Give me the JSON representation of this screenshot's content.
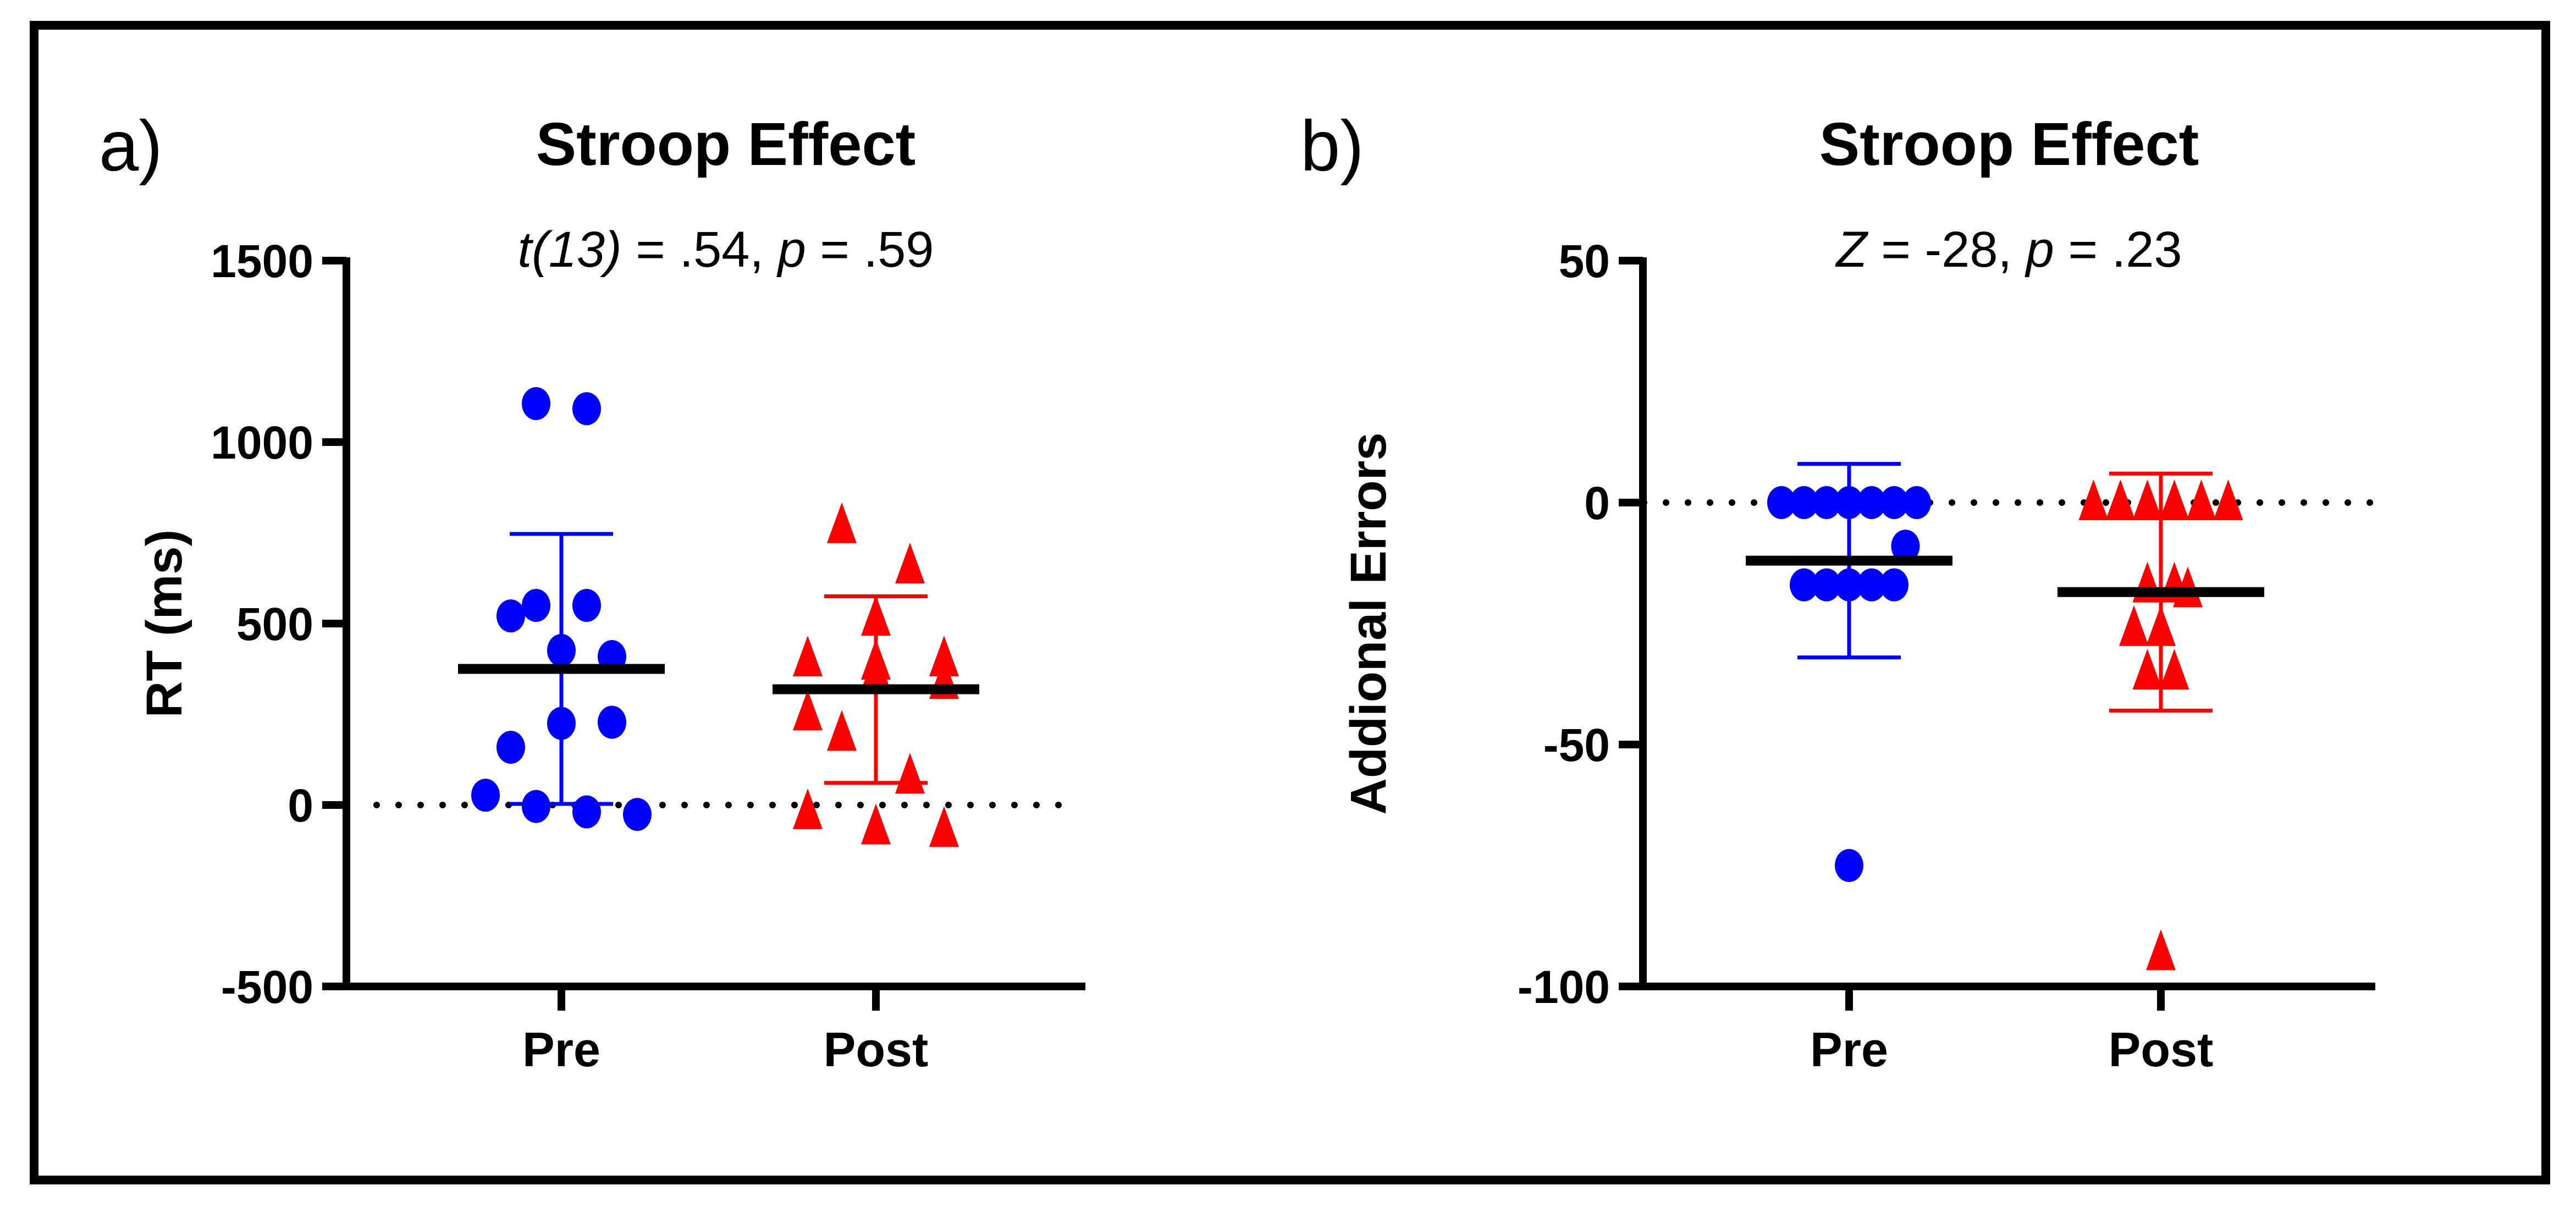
{
  "colors": {
    "pre": "#0000ff",
    "post": "#ff0000",
    "mean": "#000000",
    "frame": "#000000"
  },
  "chart_data": [
    {
      "type": "scatter",
      "panel_label": "a)",
      "title": "Stroop Effect",
      "subtitle": {
        "stat": "t(13)",
        "stat_value": " = .54, ",
        "p": "p",
        "p_value": " = .59"
      },
      "ylabel": "RT (ms)",
      "ylim": [
        -500,
        1500
      ],
      "yticks": [
        1500,
        1000,
        500,
        0,
        -500
      ],
      "categories": [
        "Pre",
        "Post"
      ],
      "reference_line": 0,
      "series": [
        {
          "category": "Pre",
          "marker": "circle",
          "color": "#0000ff",
          "values": [
            1106,
            1092,
            550,
            521,
            550,
            426,
            409,
            225,
            228,
            159,
            27,
            -4,
            -19,
            -26
          ],
          "mean": 375,
          "error_bar": [
            3,
            747
          ]
        },
        {
          "category": "Post",
          "marker": "triangle",
          "color": "#ff0000",
          "values": [
            770,
            659,
            515,
            403,
            394,
            403,
            365,
            341,
            254,
            198,
            80,
            -18,
            -60,
            -67
          ],
          "mean": 319,
          "error_bar": [
            61,
            575
          ]
        }
      ]
    },
    {
      "type": "scatter",
      "panel_label": "b)",
      "title": "Stroop Effect",
      "subtitle": {
        "stat": "Z",
        "stat_value": " = -28, ",
        "p": "p",
        "p_value": " = .23"
      },
      "ylabel": "Addional Errors",
      "ylim": [
        -100,
        50
      ],
      "yticks": [
        50,
        0,
        -50,
        -100
      ],
      "categories": [
        "Pre",
        "Post"
      ],
      "reference_line": 0,
      "series": [
        {
          "category": "Pre",
          "marker": "circle",
          "color": "#0000ff",
          "values": [
            0,
            0,
            0,
            0,
            0,
            0,
            0,
            -9,
            -17,
            -17,
            -17,
            -17,
            -17,
            -75
          ],
          "mean": -12,
          "error_bar": [
            -32,
            8
          ]
        },
        {
          "category": "Post",
          "marker": "triangle",
          "color": "#ff0000",
          "values": [
            0,
            0,
            0,
            0,
            0,
            0,
            -17,
            -17,
            -18,
            -26,
            -26,
            -35,
            -35,
            -93
          ],
          "mean": -18.5,
          "error_bar": [
            -43,
            6
          ]
        }
      ]
    }
  ]
}
